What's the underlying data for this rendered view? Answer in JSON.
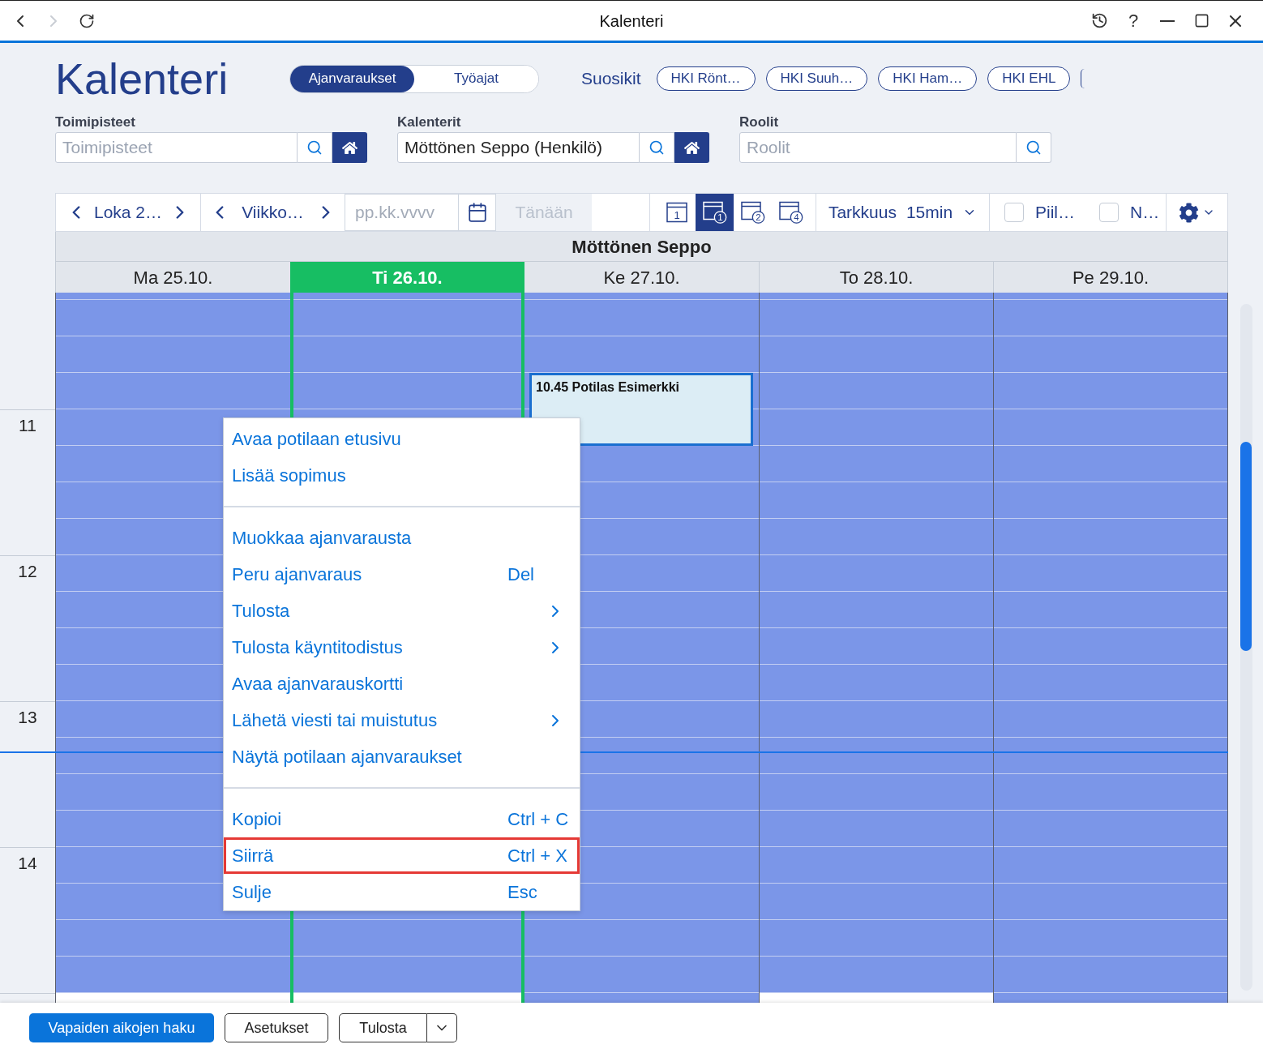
{
  "window": {
    "title": "Kalenteri",
    "nav": [
      {
        "kind": "back",
        "disabled": false
      },
      {
        "kind": "forward",
        "disabled": true
      },
      {
        "kind": "refresh",
        "disabled": false
      }
    ],
    "controls": [
      {
        "kind": "history"
      },
      {
        "kind": "help",
        "label": "?"
      },
      {
        "kind": "minimize"
      },
      {
        "kind": "maximize"
      },
      {
        "kind": "close"
      }
    ]
  },
  "header": {
    "title": "Kalenteri",
    "view_toggle": [
      {
        "label": "Ajanvaraukset",
        "selected": true
      },
      {
        "label": "Työajat",
        "selected": false
      }
    ],
    "favorites": {
      "label": "Suosikit",
      "items": [
        "HKI Rönt…",
        "HKI Suuh…",
        "HKI Ham…",
        "HKI EHL"
      ],
      "more_cut_off": true
    }
  },
  "filters": [
    {
      "label": "Toimipisteet",
      "placeholder": "Toimipisteet",
      "home_button": true
    },
    {
      "label": "Kalenterit",
      "value": "Möttönen Seppo (Henkilö)",
      "home_button": true
    },
    {
      "label": "Roolit",
      "placeholder": "Roolit",
      "home_button": false
    }
  ],
  "toolbar": {
    "month": "Loka 2…",
    "week": "Viikko…",
    "date_placeholder": "pp.kk.vvvv",
    "today": {
      "label": "Tänään",
      "disabled": true
    },
    "views": [
      {
        "kind": "day",
        "number": "1",
        "selected": false
      },
      {
        "kind": "week",
        "number": "1",
        "selected": true
      },
      {
        "kind": "week",
        "number": "2",
        "selected": false
      },
      {
        "kind": "week",
        "number": "4",
        "selected": false
      }
    ],
    "resolution": {
      "label": "Tarkkuus",
      "value": "15min"
    },
    "checkboxes": [
      {
        "label": "Piil…",
        "checked": false
      },
      {
        "label": "N…",
        "checked": false
      }
    ]
  },
  "calendar": {
    "resource": "Möttönen Seppo",
    "hours": [
      "11",
      "12",
      "13",
      "14"
    ],
    "days": [
      {
        "label": "Ma 25.10.",
        "today": false,
        "extended_hours": false
      },
      {
        "label": "Ti 26.10.",
        "today": true,
        "extended_hours": false
      },
      {
        "label": "Ke 27.10.",
        "today": false,
        "extended_hours": true,
        "events": [
          {
            "time": "10.45",
            "title": "Potilas Esimerkki"
          }
        ]
      },
      {
        "label": "To 28.10.",
        "today": false,
        "extended_hours": false
      },
      {
        "label": "Pe 29.10.",
        "today": false,
        "extended_hours": true
      }
    ]
  },
  "context_menu": {
    "groups": [
      {
        "items": [
          {
            "label": "Avaa potilaan etusivu",
            "submenu": false,
            "selected": false
          },
          {
            "label": "Lisää sopimus",
            "submenu": false,
            "selected": false
          }
        ]
      },
      {
        "items": [
          {
            "label": "Muokkaa ajanvarausta",
            "submenu": false,
            "selected": false
          },
          {
            "label": "Peru ajanvaraus",
            "shortcut": "Del",
            "submenu": false,
            "selected": false
          },
          {
            "label": "Tulosta",
            "submenu": true,
            "selected": false
          },
          {
            "label": "Tulosta käyntitodistus",
            "submenu": true,
            "selected": false
          },
          {
            "label": "Avaa ajanvarauskortti",
            "submenu": false,
            "selected": false
          },
          {
            "label": "Lähetä viesti tai muistutus",
            "submenu": true,
            "selected": false
          },
          {
            "label": "Näytä potilaan ajanvaraukset",
            "submenu": false,
            "selected": false
          }
        ]
      },
      {
        "items": [
          {
            "label": "Kopioi",
            "shortcut": "Ctrl + C",
            "submenu": false,
            "selected": false
          },
          {
            "label": "Siirrä",
            "shortcut": "Ctrl + X",
            "submenu": false,
            "selected": true
          },
          {
            "label": "Sulje",
            "shortcut": "Esc",
            "submenu": false,
            "selected": false
          }
        ]
      }
    ]
  },
  "bottom_bar": {
    "buttons": [
      {
        "kind": "search",
        "label": "Vapaiden aikojen haku"
      },
      {
        "kind": "settings",
        "label": "Asetukset"
      },
      {
        "kind": "print",
        "label": "Tulosta"
      }
    ]
  }
}
